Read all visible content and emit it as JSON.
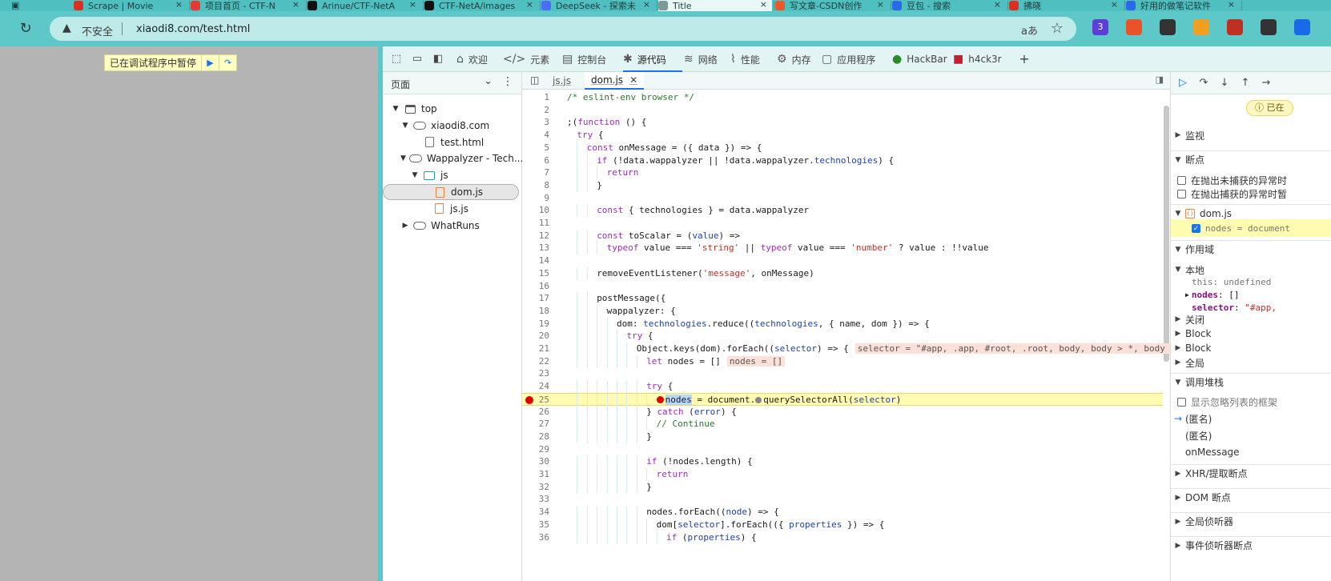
{
  "browser": {
    "tabs": [
      {
        "title": "Scrape | Movie",
        "icon_color": "#d93025"
      },
      {
        "title": "项目首页 - CTF-N",
        "icon_color": "#e53935"
      },
      {
        "title": "Arinue/CTF-NetA",
        "icon_color": "#111111"
      },
      {
        "title": "CTF-NetA/images",
        "icon_color": "#111111"
      },
      {
        "title": "DeepSeek - 探索未",
        "icon_color": "#4a6cf7"
      },
      {
        "title": "Title",
        "icon_color": "#7a9a9a"
      },
      {
        "title": "写文章-CSDN创作",
        "icon_color": "#e85a2a"
      },
      {
        "title": "豆包 - 搜索",
        "icon_color": "#2a6ae8"
      },
      {
        "title": "拂晓",
        "icon_color": "#d93025"
      },
      {
        "title": "好用的做笔记软件",
        "icon_color": "#2a6ae8"
      }
    ],
    "active_tab_title": "Title",
    "address": {
      "insecure_label": "不安全",
      "url": "xiaodi8.com/test.html",
      "read_aloud": "aあ"
    },
    "extensions": [
      {
        "name": "layers-ext-icon",
        "badge": "3",
        "color": "#5b3fd6"
      },
      {
        "name": "translate-ext-icon",
        "badge": "",
        "color": "#e8532a"
      },
      {
        "name": "headset-ext-icon",
        "badge": "",
        "color": "#333333"
      },
      {
        "name": "wheel-ext-icon",
        "badge": "",
        "color": "#f0a020"
      },
      {
        "name": "flag-ext-icon",
        "badge": "",
        "color": "#c03020"
      },
      {
        "name": "hacker-ext-icon",
        "badge": "",
        "color": "#333333"
      },
      {
        "name": "star-ext-icon",
        "badge": "",
        "color": "#1a6ae8"
      }
    ]
  },
  "page": {
    "paused_text": "已在调试程序中暂停"
  },
  "devtools": {
    "tabs": [
      "欢迎",
      "元素",
      "控制台",
      "源代码",
      "网络",
      "性能",
      "内存",
      "应用程序",
      "HackBar",
      "h4ck3r"
    ],
    "active_tab": "源代码",
    "navigator": {
      "title": "页面",
      "tree": [
        {
          "label": "top",
          "depth": 0,
          "icon": "frame",
          "expanded": "open"
        },
        {
          "label": "xiaodi8.com",
          "depth": 1,
          "icon": "cloud",
          "expanded": "open"
        },
        {
          "label": "test.html",
          "depth": 2,
          "icon": "file",
          "expanded": "none"
        },
        {
          "label": "Wappalyzer - Tech...",
          "depth": 1,
          "icon": "cloud",
          "expanded": "open"
        },
        {
          "label": "js",
          "depth": 2,
          "icon": "folder",
          "expanded": "open"
        },
        {
          "label": "dom.js",
          "depth": 3,
          "icon": "jsfile",
          "expanded": "none",
          "selected": true
        },
        {
          "label": "js.js",
          "depth": 3,
          "icon": "jsfile",
          "expanded": "none"
        },
        {
          "label": "WhatRuns",
          "depth": 1,
          "icon": "cloud",
          "expanded": "closed"
        }
      ]
    },
    "editor": {
      "tabs": [
        "js.js",
        "dom.js"
      ],
      "active_tab": "dom.js",
      "paused_line": 25,
      "breakpoint_line": 25,
      "lines": [
        {
          "n": 1,
          "indent": 0,
          "code": "/* eslint-env browser */"
        },
        {
          "n": 2,
          "indent": 0,
          "code": ""
        },
        {
          "n": 3,
          "indent": 0,
          "code": ";(function () {"
        },
        {
          "n": 4,
          "indent": 1,
          "code": "try {"
        },
        {
          "n": 5,
          "indent": 2,
          "code": "const onMessage = ({ data }) => {"
        },
        {
          "n": 6,
          "indent": 3,
          "code": "if (!data.wappalyzer || !data.wappalyzer.technologies) {"
        },
        {
          "n": 7,
          "indent": 4,
          "code": "return"
        },
        {
          "n": 8,
          "indent": 3,
          "code": "}"
        },
        {
          "n": 9,
          "indent": 0,
          "code": ""
        },
        {
          "n": 10,
          "indent": 3,
          "code": "const { technologies } = data.wappalyzer"
        },
        {
          "n": 11,
          "indent": 0,
          "code": ""
        },
        {
          "n": 12,
          "indent": 3,
          "code": "const toScalar = (value) =>"
        },
        {
          "n": 13,
          "indent": 4,
          "code": "typeof value === 'string' || typeof value === 'number' ? value : !!value"
        },
        {
          "n": 14,
          "indent": 0,
          "code": ""
        },
        {
          "n": 15,
          "indent": 3,
          "code": "removeEventListener('message', onMessage)"
        },
        {
          "n": 16,
          "indent": 0,
          "code": ""
        },
        {
          "n": 17,
          "indent": 3,
          "code": "postMessage({"
        },
        {
          "n": 18,
          "indent": 4,
          "code": "wappalyzer: {"
        },
        {
          "n": 19,
          "indent": 5,
          "code": "dom: technologies.reduce((technologies, { name, dom }) => {"
        },
        {
          "n": 20,
          "indent": 6,
          "code": "try {"
        },
        {
          "n": 21,
          "indent": 7,
          "code": "Object.keys(dom).forEach((selector) => {",
          "inline": "selector = \"#app, .app, #root, .root, body, body > *, body > *"
        },
        {
          "n": 22,
          "indent": 8,
          "code": "let nodes = []",
          "inline": "nodes = []"
        },
        {
          "n": 23,
          "indent": 0,
          "code": ""
        },
        {
          "n": 24,
          "indent": 8,
          "code": "try {"
        },
        {
          "n": 25,
          "indent": 9,
          "code": "nodes = document.querySelectorAll(selector)"
        },
        {
          "n": 26,
          "indent": 8,
          "code": "} catch (error) {"
        },
        {
          "n": 27,
          "indent": 9,
          "code": "// Continue"
        },
        {
          "n": 28,
          "indent": 8,
          "code": "}"
        },
        {
          "n": 29,
          "indent": 0,
          "code": ""
        },
        {
          "n": 30,
          "indent": 8,
          "code": "if (!nodes.length) {"
        },
        {
          "n": 31,
          "indent": 9,
          "code": "return"
        },
        {
          "n": 32,
          "indent": 8,
          "code": "}"
        },
        {
          "n": 33,
          "indent": 0,
          "code": ""
        },
        {
          "n": 34,
          "indent": 8,
          "code": "nodes.forEach((node) => {"
        },
        {
          "n": 35,
          "indent": 9,
          "code": "dom[selector].forEach(({ properties }) => {"
        },
        {
          "n": 36,
          "indent": 10,
          "code": "if (properties) {"
        }
      ]
    },
    "debugger": {
      "paused_label": "已在",
      "sections": {
        "watch": "监视",
        "breakpoints": "断点",
        "pause_uncaught": "在抛出未捕获的异常时",
        "pause_caught": "在抛出捕获的异常时暂",
        "bp_file": "dom.js",
        "bp_code": "nodes = document",
        "scope": "作用域",
        "local": "本地",
        "this_key": "this",
        "this_val": "undefined",
        "nodes_key": "nodes",
        "nodes_val": "[]",
        "selector_key": "selector",
        "selector_val": "\"#app,",
        "closure": "关闭",
        "block1": "Block",
        "block2": "Block",
        "global": "全局",
        "call_stack": "调用堆栈",
        "show_ignored": "显示忽略列表的框架",
        "frames": [
          "(匿名)",
          "(匿名)",
          "onMessage"
        ],
        "xhr": "XHR/提取断点",
        "dom_bp": "DOM 断点",
        "global_listeners": "全局侦听器",
        "event_listeners": "事件侦听器断点"
      }
    }
  }
}
